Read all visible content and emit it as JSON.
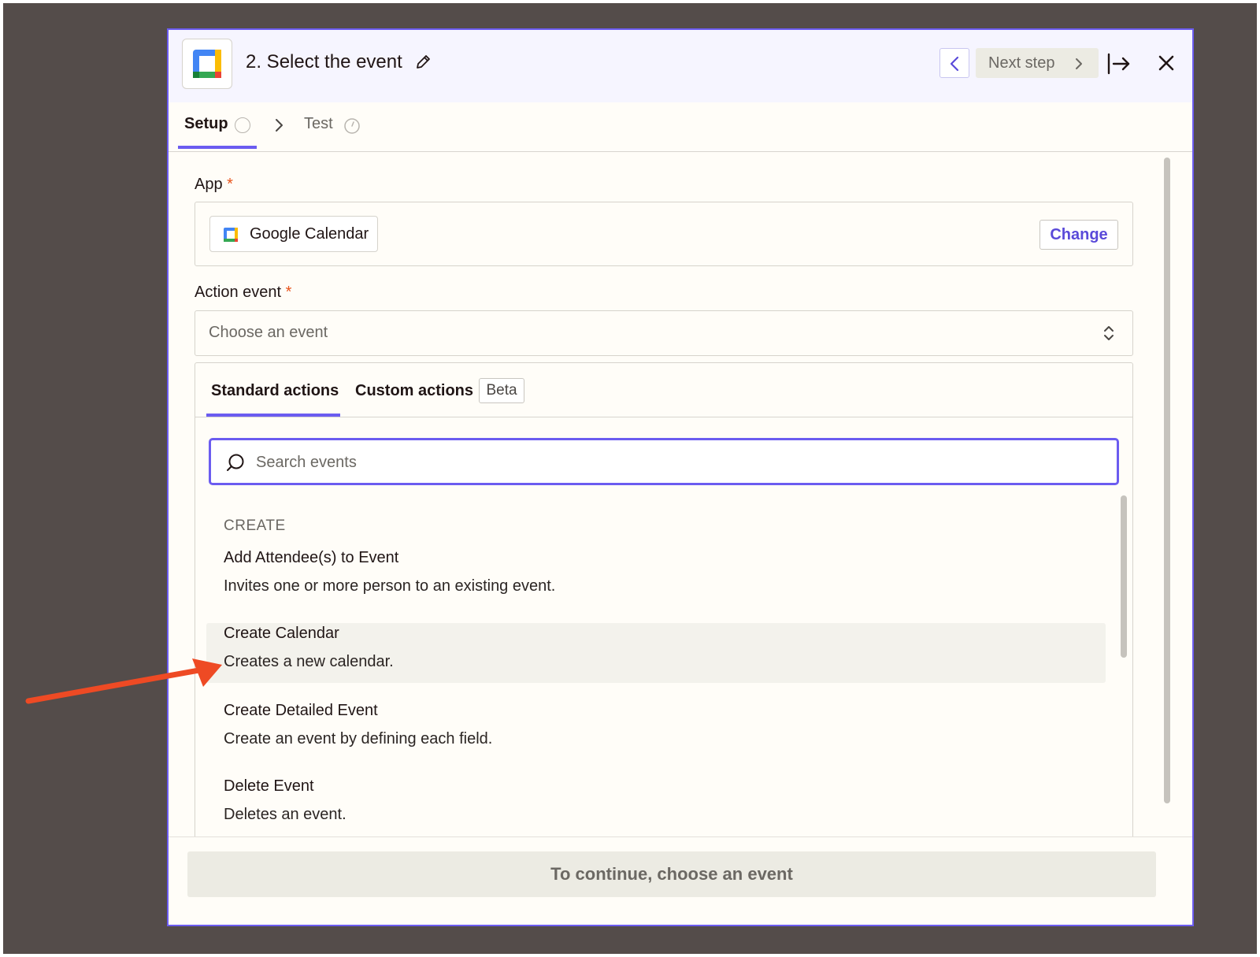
{
  "header": {
    "title": "2. Select the event",
    "next_step_label": "Next step"
  },
  "tabs": {
    "setup": "Setup",
    "test": "Test"
  },
  "app_field": {
    "label": "App",
    "required_mark": "*",
    "value": "Google Calendar",
    "change_label": "Change"
  },
  "action_field": {
    "label": "Action event",
    "required_mark": "*",
    "placeholder": "Choose an event"
  },
  "dropdown": {
    "tab_standard": "Standard actions",
    "tab_custom": "Custom actions",
    "beta_badge": "Beta",
    "search_placeholder": "Search events",
    "section_header": "CREATE",
    "events": [
      {
        "title": "Add Attendee(s) to Event",
        "description": "Invites one or more person to an existing event."
      },
      {
        "title": "Create Calendar",
        "description": "Creates a new calendar."
      },
      {
        "title": "Create Detailed Event",
        "description": "Create an event by defining each field."
      },
      {
        "title": "Delete Event",
        "description": "Deletes an event."
      }
    ]
  },
  "footer": {
    "continue_label": "To continue, choose an event"
  },
  "colors": {
    "accent": "#6b5cf0",
    "required": "#e8541c",
    "annotation_arrow": "#ee4a24",
    "backdrop": "#544c4a"
  },
  "icons": [
    "google-calendar-icon",
    "pencil-icon",
    "chevron-left-icon",
    "chevron-right-icon",
    "expand-panel-icon",
    "close-icon",
    "circle-status-icon",
    "timer-icon",
    "chevron-up-down-icon",
    "search-icon",
    "annotation-arrow"
  ]
}
